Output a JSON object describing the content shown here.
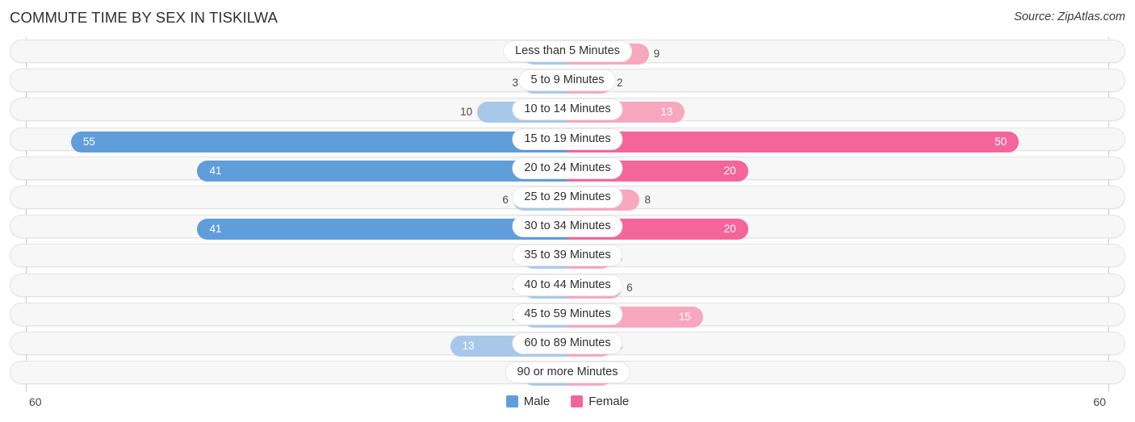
{
  "header": {
    "title": "COMMUTE TIME BY SEX IN TISKILWA",
    "source": "Source: ZipAtlas.com"
  },
  "axis": {
    "left_label": "60",
    "right_label": "60",
    "max": 60
  },
  "legend": {
    "items": [
      {
        "label": "Male",
        "color": "#5f9ddb"
      },
      {
        "label": "Female",
        "color": "#f4669a"
      }
    ]
  },
  "colors": {
    "male_light": "#a8c8ea",
    "male_dark": "#5f9ddb",
    "female_light": "#f8a7c0",
    "female_dark": "#f4669a",
    "track": "#f7f7f7",
    "track_border": "#e4e4e4"
  },
  "chart_data": {
    "type": "bar",
    "subtype": "diverging-bidirectional",
    "title": "COMMUTE TIME BY SEX IN TISKILWA",
    "xlabel": "",
    "ylabel": "",
    "xlim": [
      60,
      60
    ],
    "grid": false,
    "legend_position": "bottom-center",
    "categories": [
      "Less than 5 Minutes",
      "5 to 9 Minutes",
      "10 to 14 Minutes",
      "15 to 19 Minutes",
      "20 to 24 Minutes",
      "25 to 29 Minutes",
      "30 to 34 Minutes",
      "35 to 39 Minutes",
      "40 to 44 Minutes",
      "45 to 59 Minutes",
      "60 to 89 Minutes",
      "90 or more Minutes"
    ],
    "series": [
      {
        "name": "Male",
        "values": [
          0,
          3,
          10,
          55,
          41,
          6,
          41,
          0,
          4,
          2,
          13,
          0
        ]
      },
      {
        "name": "Female",
        "values": [
          9,
          2,
          13,
          50,
          20,
          8,
          20,
          0,
          6,
          15,
          4,
          0
        ]
      }
    ]
  },
  "rows": [
    {
      "category": "Less than 5 Minutes",
      "male": "0",
      "female": "9",
      "male_v": 0,
      "female_v": 9,
      "highlight": false
    },
    {
      "category": "5 to 9 Minutes",
      "male": "3",
      "female": "2",
      "male_v": 3,
      "female_v": 2,
      "highlight": false
    },
    {
      "category": "10 to 14 Minutes",
      "male": "10",
      "female": "13",
      "male_v": 10,
      "female_v": 13,
      "highlight": false
    },
    {
      "category": "15 to 19 Minutes",
      "male": "55",
      "female": "50",
      "male_v": 55,
      "female_v": 50,
      "highlight": true
    },
    {
      "category": "20 to 24 Minutes",
      "male": "41",
      "female": "20",
      "male_v": 41,
      "female_v": 20,
      "highlight": true
    },
    {
      "category": "25 to 29 Minutes",
      "male": "6",
      "female": "8",
      "male_v": 6,
      "female_v": 8,
      "highlight": false
    },
    {
      "category": "30 to 34 Minutes",
      "male": "41",
      "female": "20",
      "male_v": 41,
      "female_v": 20,
      "highlight": true
    },
    {
      "category": "35 to 39 Minutes",
      "male": "0",
      "female": "0",
      "male_v": 0,
      "female_v": 0,
      "highlight": false
    },
    {
      "category": "40 to 44 Minutes",
      "male": "4",
      "female": "6",
      "male_v": 4,
      "female_v": 6,
      "highlight": false
    },
    {
      "category": "45 to 59 Minutes",
      "male": "2",
      "female": "15",
      "male_v": 2,
      "female_v": 15,
      "highlight": false
    },
    {
      "category": "60 to 89 Minutes",
      "male": "13",
      "female": "4",
      "male_v": 13,
      "female_v": 4,
      "highlight": false
    },
    {
      "category": "90 or more Minutes",
      "male": "0",
      "female": "0",
      "male_v": 0,
      "female_v": 0,
      "highlight": false
    }
  ]
}
